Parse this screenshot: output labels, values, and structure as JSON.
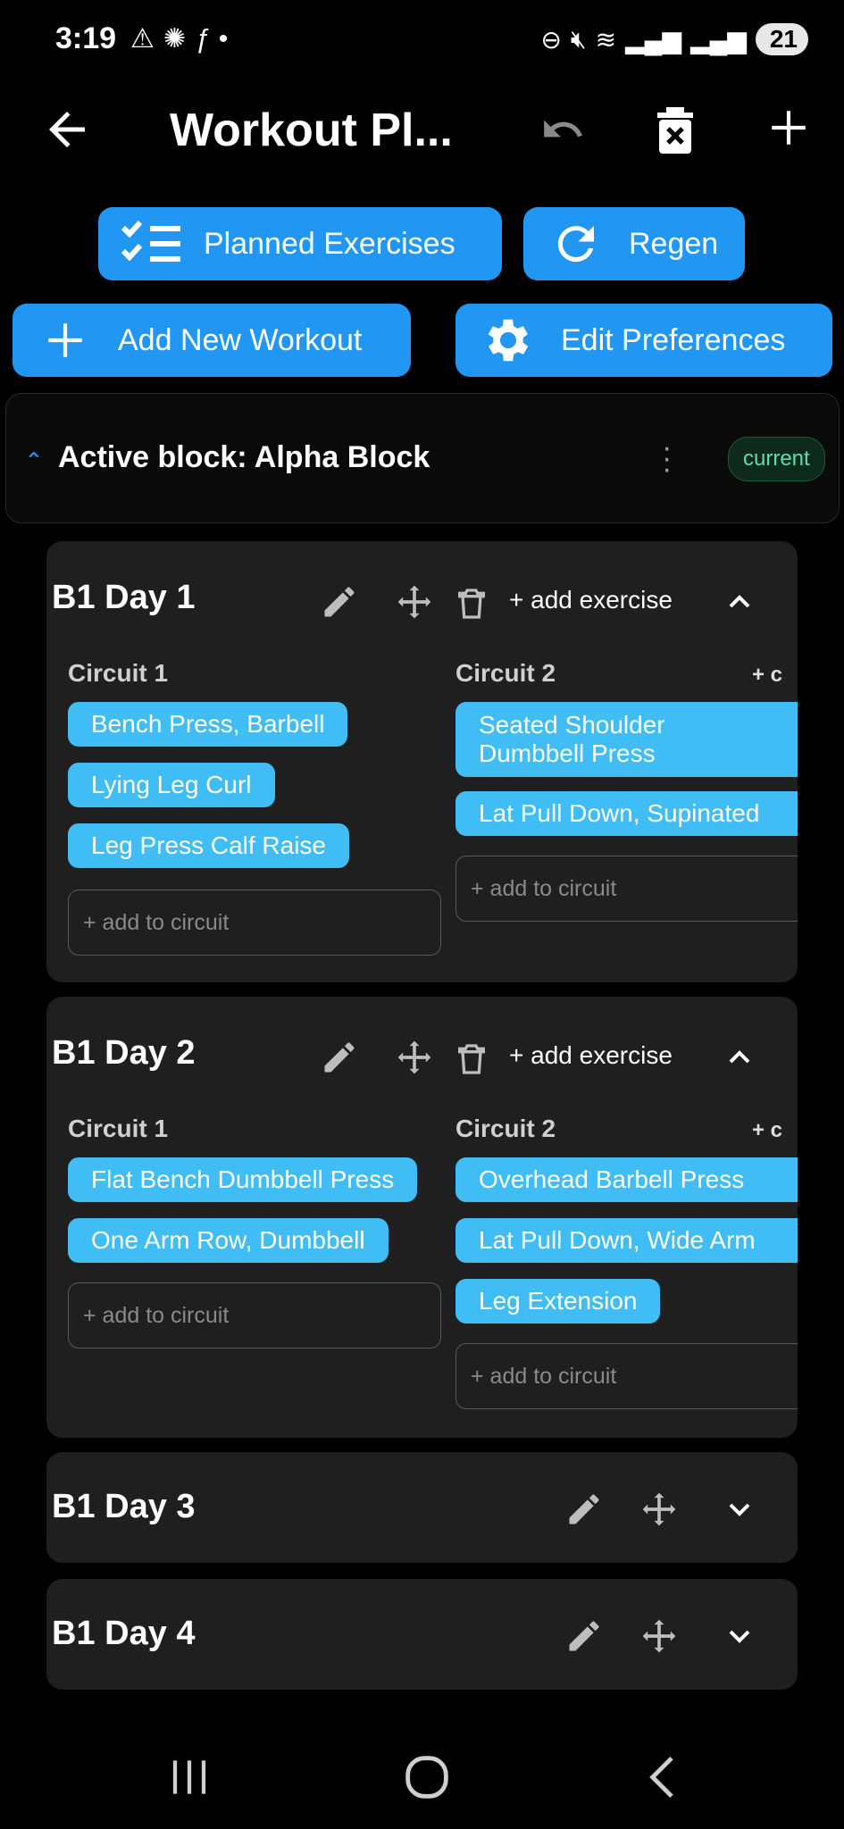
{
  "status_bar": {
    "time": "3:19",
    "battery": "21"
  },
  "app_bar": {
    "title": "Workout Pl..."
  },
  "actions": {
    "planned_exercises": "Planned Exercises",
    "regen": "Regen",
    "add_new_workout": "Add New Workout",
    "edit_preferences": "Edit Preferences"
  },
  "active_block": {
    "label": "Active block: Alpha Block",
    "badge": "current"
  },
  "days": [
    {
      "title": "B1 Day 1",
      "add_exercise": "+ add exercise",
      "circuits": [
        {
          "title": "Circuit 1",
          "exercises": [
            "Bench Press, Barbell",
            "Lying Leg Curl",
            "Leg Press Calf Raise"
          ],
          "add_placeholder": "+ add to circuit"
        },
        {
          "title": "Circuit 2",
          "exercises": [
            "Seated Shoulder Dumbbell Press",
            "Lat Pull Down, Supinated"
          ],
          "add_placeholder": "+ add to circuit"
        }
      ],
      "overflow_hint": "+ c"
    },
    {
      "title": "B1 Day 2",
      "add_exercise": "+ add exercise",
      "circuits": [
        {
          "title": "Circuit 1",
          "exercises": [
            "Flat Bench Dumbbell Press",
            "One Arm Row, Dumbbell"
          ],
          "add_placeholder": "+ add to circuit"
        },
        {
          "title": "Circuit 2",
          "exercises": [
            "Overhead Barbell Press",
            "Lat Pull Down, Wide Arm",
            "Leg Extension"
          ],
          "add_placeholder": "+ add to circuit"
        }
      ],
      "overflow_hint": "+ c"
    },
    {
      "title": "B1 Day 3"
    },
    {
      "title": "B1 Day 4"
    }
  ],
  "colors": {
    "primary": "#2196f3",
    "chip": "#40bdf5",
    "card": "#1f1f1f",
    "badge_text": "#5ce0a6"
  }
}
